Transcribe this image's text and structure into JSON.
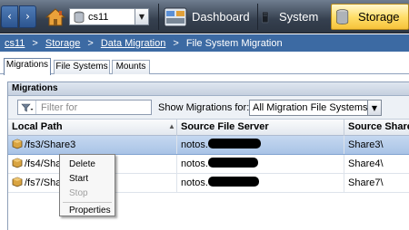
{
  "topbar": {
    "back_icon": "chevron-left-icon",
    "forward_icon": "chevron-right-icon",
    "home_icon": "home-icon",
    "system_select": {
      "value": "cs11",
      "icon": "database-icon"
    },
    "tabs": [
      {
        "label": "Dashboard",
        "icon": "dashboard-icon"
      },
      {
        "label": "System",
        "icon": "server-icon"
      },
      {
        "label": "Storage",
        "icon": "storage-cylinder-icon",
        "active": true
      }
    ]
  },
  "breadcrumb": {
    "items": [
      "cs11",
      "Storage",
      "Data Migration"
    ],
    "current": "File System Migration",
    "separator": ">"
  },
  "subtabs": [
    "Migrations",
    "File Systems",
    "Mounts"
  ],
  "panel": {
    "title": "Migrations",
    "filter_placeholder": "Filter for",
    "show_label": "Show Migrations for:",
    "show_value": "All Migration File Systems"
  },
  "grid": {
    "columns": [
      "Local Path",
      "Source File Server",
      "Source Share/"
    ],
    "rows": [
      {
        "local_path": "/fs3/Share3",
        "server": "notos.",
        "share": "Share3\\",
        "selected": true
      },
      {
        "local_path": "/fs4/Share4",
        "server": "notos.",
        "share": "Share4\\",
        "selected": false
      },
      {
        "local_path": "/fs7/Share7",
        "server": "notos.",
        "share": "Share7\\",
        "selected": false
      }
    ]
  },
  "context_menu": {
    "items": [
      {
        "label": "Delete",
        "enabled": true
      },
      {
        "label": "Start",
        "enabled": true
      },
      {
        "label": "Stop",
        "enabled": false
      },
      {
        "label": "Properties",
        "enabled": true
      }
    ]
  },
  "colors": {
    "accent_blue": "#3c6aa3",
    "storage_tab": "#ffdf6a",
    "selected_row": "#b8cdeb"
  }
}
